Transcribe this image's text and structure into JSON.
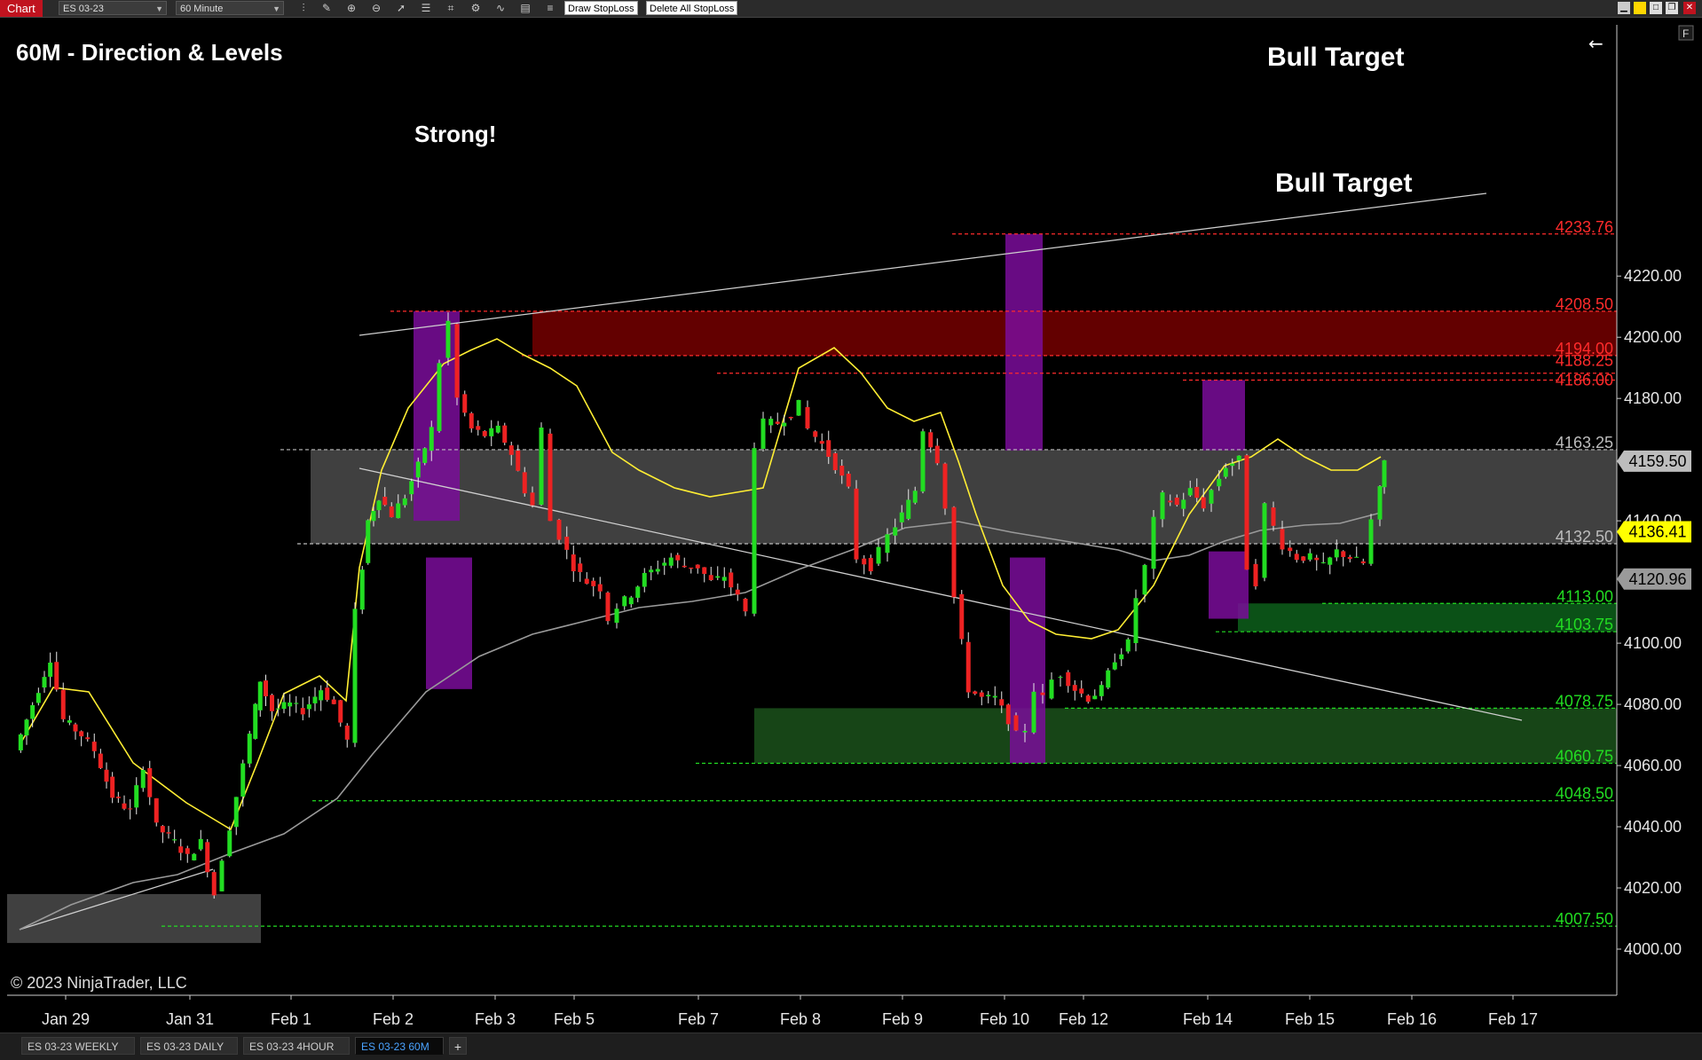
{
  "toolbar": {
    "title": "Chart",
    "instrument": "ES 03-23",
    "interval": "60 Minute",
    "draw_stoploss": "Draw StopLoss",
    "delete_stoploss": "Delete All StopLoss",
    "icons": [
      "bar-style-icon",
      "draw-tool-icon",
      "zoom-in-icon",
      "zoom-out-icon",
      "pointer-icon",
      "properties-icon",
      "templates-icon",
      "strategies-icon",
      "indicators-icon",
      "data-box-icon",
      "more-icon"
    ]
  },
  "chart": {
    "title": "60M - Direction & Levels",
    "copyright": "© 2023 NinjaTrader, LLC",
    "annotation_strong": "Strong!",
    "annotation_bull_target_1": "Bull Target",
    "annotation_bull_target_2": "Bull Target",
    "back_arrow": "←",
    "f_button": "F"
  },
  "chart_data": {
    "type": "candlestick",
    "title": "60M - Direction & Levels",
    "instrument": "ES 03-23",
    "interval": "60 Minute",
    "ylim": [
      3993,
      4245
    ],
    "x_tick_labels": [
      "Jan 29",
      "Jan 31",
      "Feb 1",
      "Feb 2",
      "Feb 3",
      "Feb 5",
      "Feb 7",
      "Feb 8",
      "Feb 9",
      "Feb 10",
      "Feb 12",
      "Feb 14",
      "Feb 15",
      "Feb 16",
      "Feb 17"
    ],
    "y_tick_labels": [
      "4220.00",
      "4200.00",
      "4180.00",
      "4140.00",
      "4100.00",
      "4080.00",
      "4060.00",
      "4040.00",
      "4020.00",
      "4000.00"
    ],
    "price_markers": [
      {
        "label": "4159.50",
        "value": 4159.5,
        "bg": "#bdbdbd",
        "fg": "#000000"
      },
      {
        "label": "4136.41",
        "value": 4136.41,
        "bg": "#ffff00",
        "fg": "#000000"
      },
      {
        "label": "4120.96",
        "value": 4120.96,
        "bg": "#9a9a9a",
        "fg": "#000000"
      }
    ],
    "levels": [
      {
        "label": "4233.76",
        "value": 4233.76,
        "color": "#ff2b2b"
      },
      {
        "label": "4208.50",
        "value": 4208.5,
        "color": "#ff2b2b"
      },
      {
        "label": "4194.00",
        "value": 4194.0,
        "color": "#ff2b2b"
      },
      {
        "label": "4188.25",
        "value": 4188.25,
        "color": "#ff2b2b"
      },
      {
        "label": "4186.00",
        "value": 4186.0,
        "color": "#ff2b2b"
      },
      {
        "label": "4163.25",
        "value": 4163.25,
        "color": "#bdbdbd"
      },
      {
        "label": "4132.50",
        "value": 4132.5,
        "color": "#bdbdbd"
      },
      {
        "label": "4113.00",
        "value": 4113.0,
        "color": "#22dd22"
      },
      {
        "label": "4103.75",
        "value": 4103.75,
        "color": "#22dd22"
      },
      {
        "label": "4078.75",
        "value": 4078.75,
        "color": "#22dd22"
      },
      {
        "label": "4060.75",
        "value": 4060.75,
        "color": "#22dd22"
      },
      {
        "label": "4048.50",
        "value": 4048.5,
        "color": "#22dd22"
      },
      {
        "label": "4007.50",
        "value": 4007.5,
        "color": "#22dd22"
      }
    ],
    "zones": [
      {
        "type": "supply",
        "from": 4194.0,
        "to": 4208.5,
        "color": "#6e0000"
      },
      {
        "type": "range",
        "from": 4132.5,
        "to": 4163.25,
        "color": "#555555"
      },
      {
        "type": "demand",
        "from": 4103.75,
        "to": 4113.0,
        "color": "#0c5a1a"
      },
      {
        "type": "demand",
        "from": 4060.75,
        "to": 4078.75,
        "color": "#1a4d1a"
      },
      {
        "type": "range",
        "from": 4002,
        "to": 4018,
        "color": "#555555"
      }
    ],
    "sessions": [
      "Jan 29",
      "Jan 31",
      "Feb 1",
      "Feb 2",
      "Feb 3",
      "Feb 5",
      "Feb 7",
      "Feb 8",
      "Feb 9",
      "Feb 10",
      "Feb 12",
      "Feb 14",
      "Feb 15"
    ],
    "session_close": [
      4068,
      4026,
      4088,
      4138,
      4170,
      4108,
      4120,
      4175,
      4152,
      4072,
      4086,
      4142,
      4159.5
    ],
    "ma_fast_color": "#ffee33",
    "ma_slow_color": "#9a9a9a",
    "up_color": "#22dd22",
    "down_color": "#ee2222"
  },
  "tabs": [
    {
      "label": "ES 03-23 WEEKLY",
      "active": false
    },
    {
      "label": "ES 03-23 DAILY",
      "active": false
    },
    {
      "label": "ES 03-23 4HOUR",
      "active": false
    },
    {
      "label": "ES 03-23 60M",
      "active": true
    }
  ],
  "tab_add": "+"
}
